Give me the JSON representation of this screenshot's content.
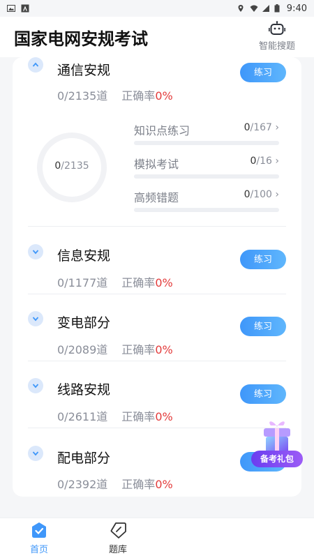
{
  "status_bar": {
    "time": "9:40"
  },
  "header": {
    "title": "国家电网安规考试",
    "smart_search_label": "智能搜题"
  },
  "sections": [
    {
      "title": "通信安规",
      "practice_label": "练习",
      "stats_count": "0/2135道",
      "accuracy_label": "正确率",
      "accuracy_value": "0%",
      "expanded": true,
      "ring": {
        "done": "0",
        "total": "/2135"
      },
      "subitems": [
        {
          "name": "知识点练习",
          "done": "0",
          "total": "/167",
          "progress": 0
        },
        {
          "name": "模拟考试",
          "done": "0",
          "total": "/16",
          "progress": 0
        },
        {
          "name": "高频错题",
          "done": "0",
          "total": "/100",
          "progress": 0
        }
      ]
    },
    {
      "title": "信息安规",
      "practice_label": "练习",
      "stats_count": "0/1177道",
      "accuracy_label": "正确率",
      "accuracy_value": "0%",
      "expanded": false
    },
    {
      "title": "变电部分",
      "practice_label": "练习",
      "stats_count": "0/2089道",
      "accuracy_label": "正确率",
      "accuracy_value": "0%",
      "expanded": false
    },
    {
      "title": "线路安规",
      "practice_label": "练习",
      "stats_count": "0/2611道",
      "accuracy_label": "正确率",
      "accuracy_value": "0%",
      "expanded": false
    },
    {
      "title": "配电部分",
      "practice_label": "练习",
      "stats_count": "0/2392道",
      "accuracy_label": "正确率",
      "accuracy_value": "0%",
      "expanded": false
    }
  ],
  "gift": {
    "label": "备考礼包"
  },
  "tabs": [
    {
      "label": "首页",
      "icon": "home-icon",
      "active": true
    },
    {
      "label": "题库",
      "icon": "question-bank-icon",
      "active": false
    }
  ],
  "colors": {
    "accent": "#3f97fa",
    "accuracy": "#e33b3b",
    "gift": "#7a48f2"
  }
}
